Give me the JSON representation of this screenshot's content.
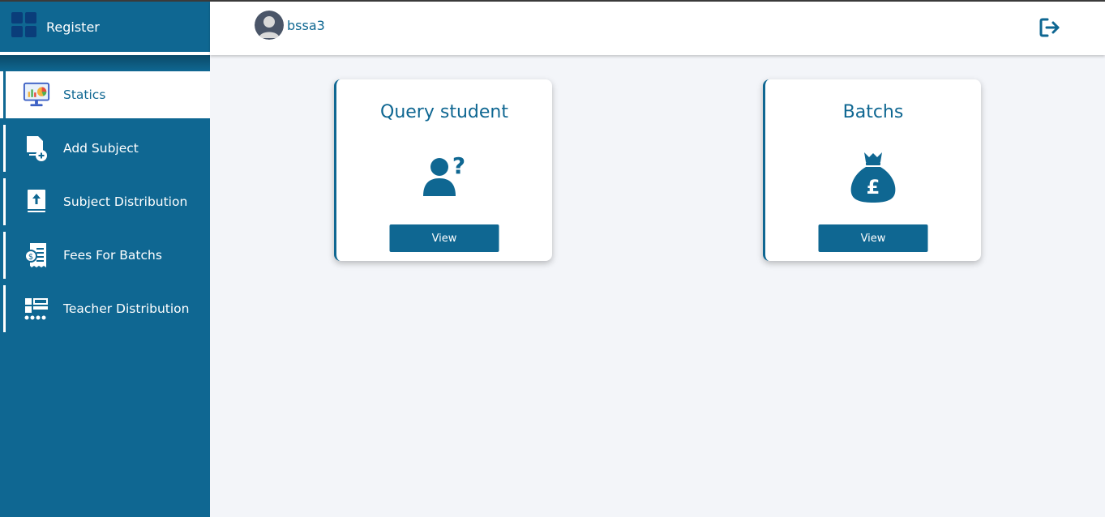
{
  "sidebar": {
    "brand_title": "Register",
    "items": [
      {
        "label": "Statics",
        "icon": "statistics-monitor-icon",
        "active": true
      },
      {
        "label": "Add Subject",
        "icon": "add-document-icon"
      },
      {
        "label": "Subject Distribution",
        "icon": "upload-book-icon"
      },
      {
        "label": "Fees For Batchs",
        "icon": "fees-receipt-icon"
      },
      {
        "label": "Teacher Distribution",
        "icon": "distribution-network-icon"
      }
    ]
  },
  "header": {
    "username": "bssa3",
    "avatar_icon": "user-avatar-icon",
    "logout_icon": "logout-icon"
  },
  "cards": [
    {
      "title": "Query student",
      "icon": "user-question-icon",
      "button_label": "View"
    },
    {
      "title": "Batchs",
      "icon": "money-bag-pound-icon",
      "button_label": "View"
    }
  ],
  "colors": {
    "primary": "#0f6792",
    "background": "#f3f5f9",
    "card": "#ffffff"
  }
}
